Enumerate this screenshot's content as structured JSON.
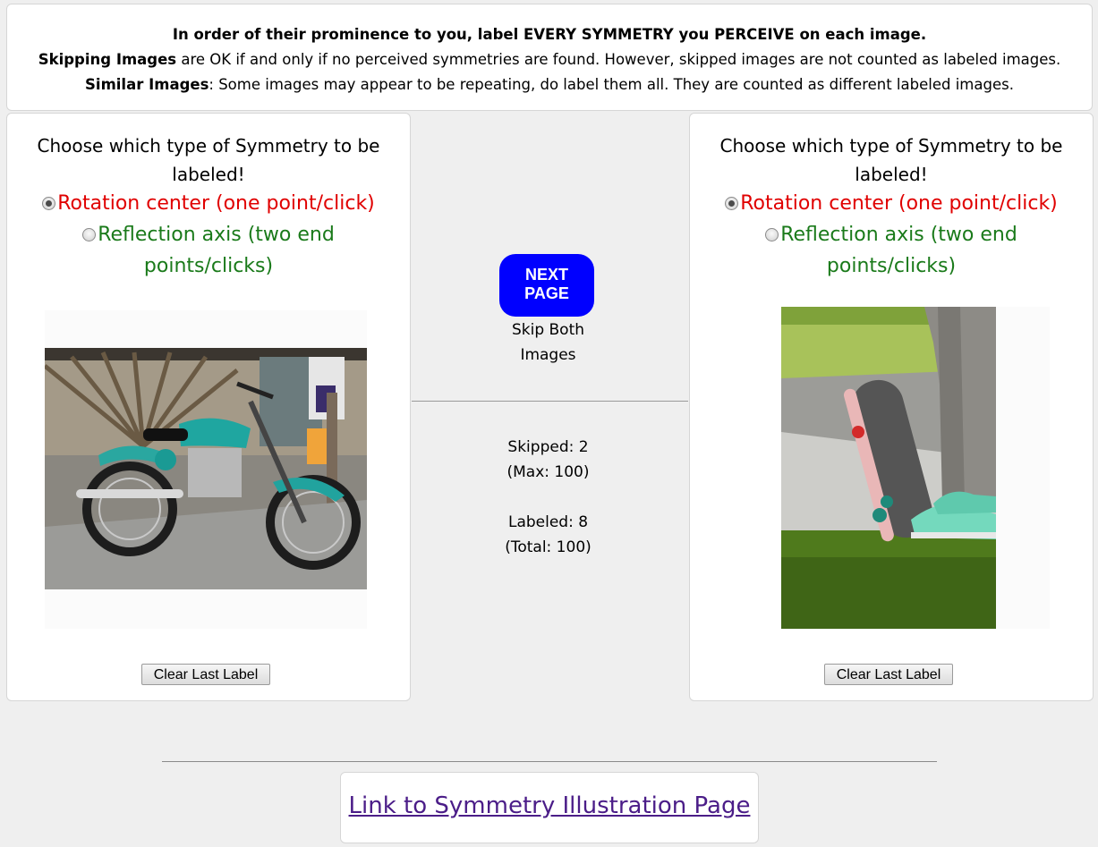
{
  "instructions": {
    "line1": "In order of their prominence to you, label EVERY SYMMETRY you PERCEIVE on each image.",
    "skip_bold": "Skipping Images",
    "skip_text": " are OK if and only if no perceived symmetries are found. However, skipped images are not counted as labeled images.",
    "similar_bold": "Similar Images",
    "similar_text": ": Some images may appear to be repeating, do label them all. They are counted as different labeled images."
  },
  "left_panel": {
    "choose_text": "Choose which type of Symmetry to be labeled!",
    "option_rotation": "Rotation center (one point/click)",
    "option_reflection": "Reflection axis (two end points/clicks)",
    "selected": "rotation",
    "image_subject": "motorcycle photo",
    "clear_button": "Clear Last Label"
  },
  "right_panel": {
    "choose_text": "Choose which type of Symmetry to be labeled!",
    "option_rotation": "Rotation center (one point/click)",
    "option_reflection": "Reflection axis (two end points/clicks)",
    "selected": "rotation",
    "image_subject": "skateboard photo",
    "clear_button": "Clear Last Label"
  },
  "center": {
    "next_button_line1": "NEXT",
    "next_button_line2": "PAGE",
    "skip_line1": "Skip Both",
    "skip_line2": "Images",
    "skipped": "Skipped: 2",
    "skipped_max": "(Max: 100)",
    "labeled": "Labeled: 8",
    "labeled_total": "(Total: 100)"
  },
  "footer": {
    "link_text": "Link to Symmetry Illustration Page"
  },
  "colors": {
    "rotation": "#e00000",
    "reflection": "#1a7a1a",
    "next_button": "#0000ff",
    "link": "#4b1d88"
  }
}
